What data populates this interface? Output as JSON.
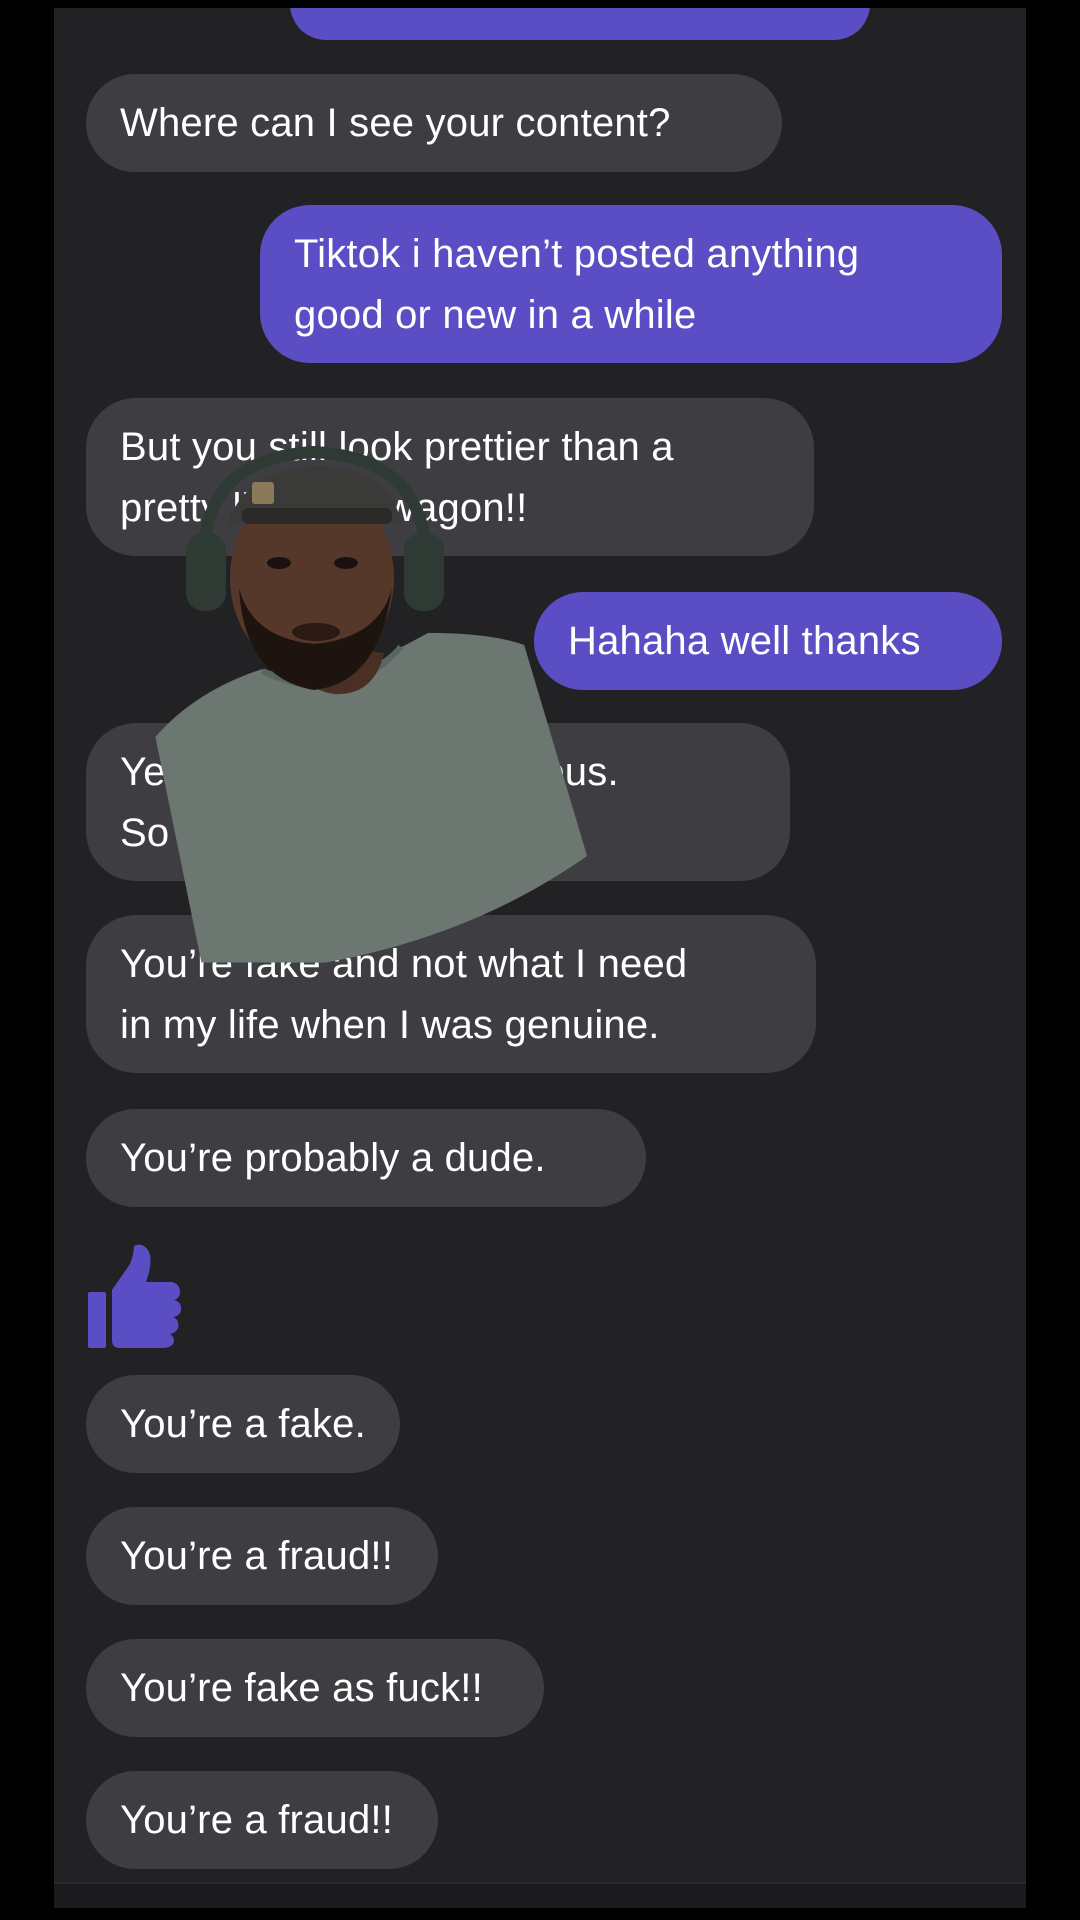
{
  "conversation": {
    "messages": [
      {
        "side": "in",
        "text": "Where can I see your content?"
      },
      {
        "side": "out",
        "text": "Tiktok i haven’t posted anything\ngood or new in a while"
      },
      {
        "side": "in",
        "text": "But you still look prettier than a\npretty little red wagon!!"
      },
      {
        "side": "out",
        "text": "Hahaha well thanks"
      },
      {
        "side": "in",
        "text": "Yeah but you're not serious.\nSo"
      },
      {
        "side": "in",
        "text": "You’re fake and not what I need\nin my life when I was genuine."
      },
      {
        "side": "in",
        "text": "You’re probably a dude."
      },
      {
        "side": "out",
        "reaction": "thumbs-up"
      },
      {
        "side": "in",
        "text": "You’re a fake."
      },
      {
        "side": "in",
        "text": "You’re a fraud!!"
      },
      {
        "side": "in",
        "text": "You’re fake as fuck!!"
      },
      {
        "side": "in",
        "text": "You’re a fraud!!"
      }
    ]
  },
  "overlay": {
    "type": "reaction-cutout",
    "subject": "man with headphones and cap"
  },
  "colors": {
    "background": "#222224",
    "incoming_bubble": "#3e3e42",
    "outgoing_bubble": "#5b4ec4",
    "text": "#ffffff"
  }
}
